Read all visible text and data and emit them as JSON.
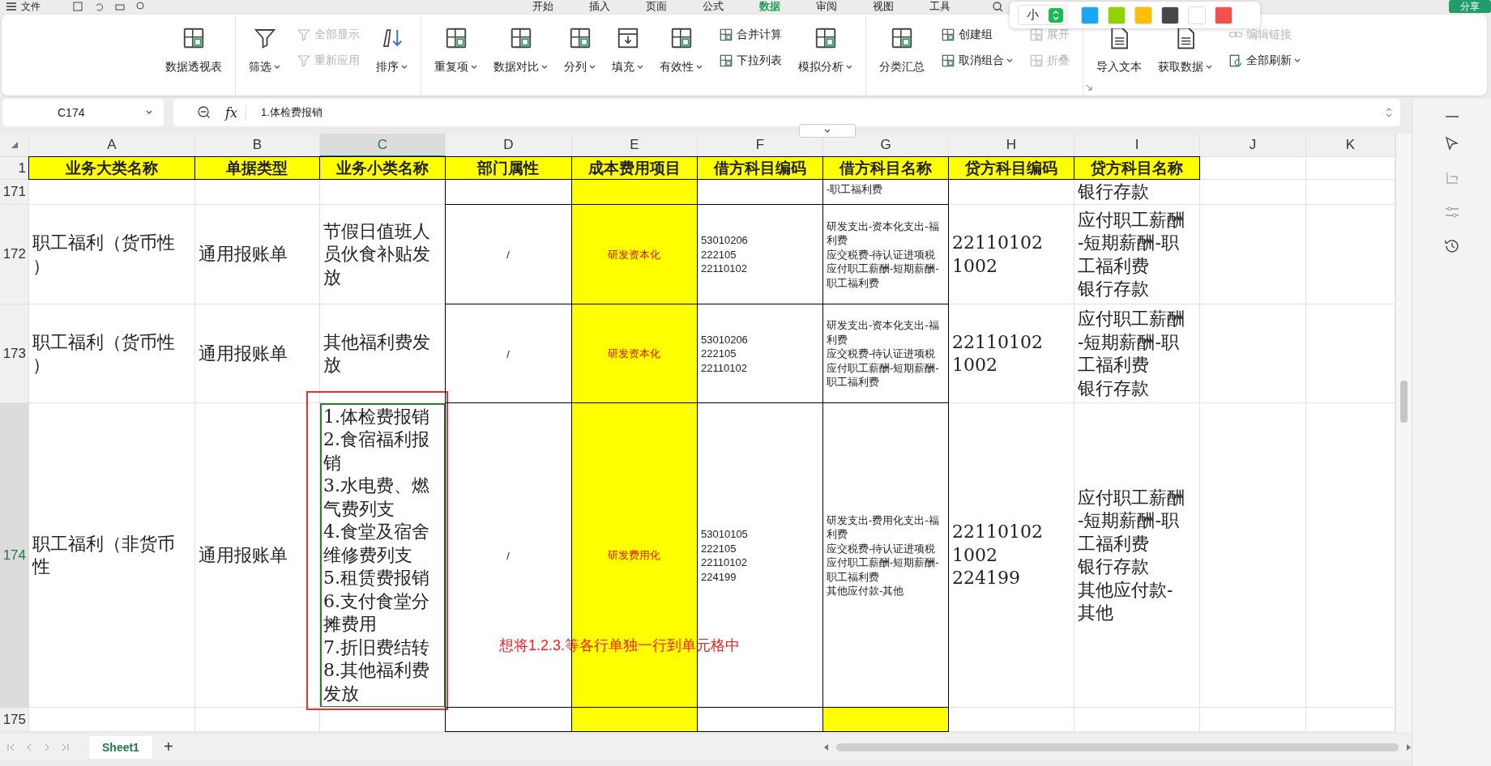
{
  "menu_bar": {
    "file": "文件",
    "tabs": [
      {
        "label": "开始",
        "selected": false
      },
      {
        "label": "插入",
        "selected": false
      },
      {
        "label": "页面",
        "selected": false
      },
      {
        "label": "公式",
        "selected": false
      },
      {
        "label": "数据",
        "selected": true
      },
      {
        "label": "审阅",
        "selected": false
      },
      {
        "label": "视图",
        "selected": false
      },
      {
        "label": "工具",
        "selected": false
      }
    ],
    "share": "分享"
  },
  "color_popup": {
    "size": "小",
    "swatches": [
      {
        "color": "#16a8f5"
      },
      {
        "color": "#8fd400"
      },
      {
        "color": "#ffc000"
      },
      {
        "color": "#474747"
      },
      {
        "color": "#ffffff"
      },
      {
        "color": "#f5504a"
      }
    ]
  },
  "ribbon": {
    "groups": [
      {
        "columns": [
          {
            "kind": "large",
            "items": [
              {
                "label": "数据透视表",
                "dropdown": false,
                "disabled": false
              }
            ]
          }
        ]
      },
      {
        "columns": [
          {
            "kind": "large",
            "items": [
              {
                "label": "筛选",
                "dropdown": true,
                "disabled": false
              }
            ]
          },
          {
            "kind": "stack",
            "items": [
              {
                "label": "全部显示",
                "dropdown": false,
                "disabled": true
              },
              {
                "label": "重新应用",
                "dropdown": false,
                "disabled": true
              }
            ]
          },
          {
            "kind": "large",
            "items": [
              {
                "label": "排序",
                "dropdown": true,
                "disabled": false
              }
            ]
          }
        ]
      },
      {
        "columns": [
          {
            "kind": "large",
            "items": [
              {
                "label": "重复项",
                "dropdown": true,
                "disabled": false
              }
            ]
          },
          {
            "kind": "large",
            "items": [
              {
                "label": "数据对比",
                "dropdown": true,
                "disabled": false
              }
            ]
          },
          {
            "kind": "large",
            "items": [
              {
                "label": "分列",
                "dropdown": true,
                "disabled": false
              }
            ]
          },
          {
            "kind": "large",
            "items": [
              {
                "label": "填充",
                "dropdown": true,
                "disabled": false
              }
            ]
          },
          {
            "kind": "large",
            "items": [
              {
                "label": "有效性",
                "dropdown": true,
                "disabled": false
              }
            ]
          },
          {
            "kind": "stack",
            "items": [
              {
                "label": "合并计算",
                "dropdown": false,
                "disabled": false
              },
              {
                "label": "下拉列表",
                "dropdown": false,
                "disabled": false
              }
            ]
          },
          {
            "kind": "large",
            "items": [
              {
                "label": "模拟分析",
                "dropdown": true,
                "disabled": false
              }
            ]
          }
        ]
      },
      {
        "columns": [
          {
            "kind": "large",
            "items": [
              {
                "label": "分类汇总",
                "dropdown": false,
                "disabled": false
              }
            ]
          },
          {
            "kind": "stack",
            "items": [
              {
                "label": "创建组",
                "dropdown": false,
                "disabled": false
              },
              {
                "label": "取消组合",
                "dropdown": true,
                "disabled": false
              }
            ]
          },
          {
            "kind": "stack",
            "items": [
              {
                "label": "展开",
                "dropdown": false,
                "disabled": true
              },
              {
                "label": "折叠",
                "dropdown": false,
                "disabled": true
              }
            ]
          }
        ]
      },
      {
        "columns": [
          {
            "kind": "large",
            "items": [
              {
                "label": "导入文本",
                "dropdown": false,
                "disabled": false
              }
            ]
          },
          {
            "kind": "large",
            "items": [
              {
                "label": "获取数据",
                "dropdown": true,
                "disabled": false
              }
            ]
          },
          {
            "kind": "stack",
            "items": [
              {
                "label": "编辑链接",
                "dropdown": false,
                "disabled": true
              },
              {
                "label": "全部刷新",
                "dropdown": true,
                "disabled": false
              }
            ]
          }
        ]
      }
    ]
  },
  "formula_bar": {
    "cell_ref": "C174",
    "fx": "fx",
    "formula": "1.体检费报销"
  },
  "sheet": {
    "columns": [
      {
        "label": "A",
        "selected": false
      },
      {
        "label": "B",
        "selected": false
      },
      {
        "label": "C",
        "selected": true
      },
      {
        "label": "D",
        "selected": false
      },
      {
        "label": "E",
        "selected": false
      },
      {
        "label": "F",
        "selected": false
      },
      {
        "label": "G",
        "selected": false
      },
      {
        "label": "H",
        "selected": false
      },
      {
        "label": "I",
        "selected": false
      },
      {
        "label": "J",
        "selected": false
      },
      {
        "label": "K",
        "selected": false
      }
    ],
    "rows": [
      {
        "number": "1",
        "selected": false,
        "cells": [
          {
            "kind": "header",
            "text": "业务大类名称",
            "color": "#ffff00",
            "bordered": true,
            "selected": false
          },
          {
            "kind": "header",
            "text": "单据类型",
            "color": "#ffff00",
            "bordered": true,
            "selected": false
          },
          {
            "kind": "header",
            "text": "业务小类名称",
            "color": "#ffff00",
            "bordered": true,
            "selected": false
          },
          {
            "kind": "header",
            "text": "部门属性",
            "color": "#ffff00",
            "bordered": true,
            "selected": false
          },
          {
            "kind": "header",
            "text": "成本费用项目",
            "color": "#ffff00",
            "bordered": true,
            "selected": false
          },
          {
            "kind": "header",
            "text": "借方科目编码",
            "color": "#ffff00",
            "bordered": true,
            "selected": false
          },
          {
            "kind": "header",
            "text": "借方科目名称",
            "color": "#ffff00",
            "bordered": true,
            "selected": false
          },
          {
            "kind": "header",
            "text": "贷方科目编码",
            "color": "#ffff00",
            "bordered": true,
            "selected": false
          },
          {
            "kind": "header",
            "text": "贷方科目名称",
            "color": "#ffff00",
            "bordered": true,
            "selected": false
          }
        ]
      },
      {
        "number": "171",
        "selected": false,
        "cells": [
          "",
          "",
          "",
          {
            "kind": "centered",
            "bordered": true,
            "selected": false
          },
          {
            "kind": "flagged",
            "color": "#ffff00",
            "bordered": true,
            "selected": false
          },
          {
            "kind": "small",
            "bordered": true,
            "selected": false
          },
          {
            "kind": "top",
            "text": "-职工福利费",
            "bordered": true,
            "selected": false
          },
          "",
          {
            "kind": "large",
            "text": "银行存款",
            "bordered": false,
            "selected": false
          }
        ]
      },
      {
        "number": "172",
        "selected": false,
        "cells": [
          {
            "kind": "large",
            "text": "职工福利（货币性）",
            "bordered": false,
            "selected": false
          },
          {
            "kind": "large",
            "text": "通用报账单",
            "bordered": false,
            "selected": false
          },
          {
            "kind": "large",
            "text": "节假日值班人员伙食补贴发放",
            "bordered": false,
            "selected": false
          },
          {
            "kind": "centered",
            "text": "/",
            "bordered": true,
            "selected": false
          },
          {
            "kind": "flagged",
            "text": "研发资本化",
            "color": "#ffff00",
            "bordered": true,
            "selected": false
          },
          {
            "kind": "small",
            "lines": [
              "53010206",
              "222105",
              "22110102"
            ],
            "bordered": true,
            "selected": false
          },
          {
            "kind": "small",
            "lines": [
              "研发支出-资本化支出-福利费",
              "应交税费-待认证进项税",
              "应付职工薪酬-短期薪酬-职工福利费"
            ],
            "bordered": true,
            "selected": false
          },
          {
            "kind": "large",
            "lines": [
              "22110102",
              "1002"
            ],
            "bordered": false,
            "selected": false
          },
          {
            "kind": "large",
            "lines": [
              "应付职工薪酬-短期薪酬-职工福利费",
              "银行存款"
            ],
            "bordered": false,
            "selected": false
          }
        ]
      },
      {
        "number": "173",
        "selected": false,
        "cells": [
          {
            "kind": "large",
            "text": "职工福利（货币性）",
            "bordered": false,
            "selected": false
          },
          {
            "kind": "large",
            "text": "通用报账单",
            "bordered": false,
            "selected": false
          },
          {
            "kind": "large",
            "text": "其他福利费发放",
            "bordered": false,
            "selected": false
          },
          {
            "kind": "centered",
            "text": "/",
            "bordered": true,
            "selected": false
          },
          {
            "kind": "flagged",
            "text": "研发资本化",
            "color": "#ffff00",
            "bordered": true,
            "selected": false
          },
          {
            "kind": "small",
            "lines": [
              "53010206",
              "222105",
              "22110102"
            ],
            "bordered": true,
            "selected": false
          },
          {
            "kind": "small",
            "lines": [
              "研发支出-资本化支出-福利费",
              "应交税费-待认证进项税",
              "应付职工薪酬-短期薪酬-职工福利费"
            ],
            "bordered": true,
            "selected": false
          },
          {
            "kind": "large",
            "lines": [
              "22110102",
              "1002"
            ],
            "bordered": false,
            "selected": false
          },
          {
            "kind": "large",
            "lines": [
              "应付职工薪酬-短期薪酬-职工福利费",
              "银行存款"
            ],
            "bordered": false,
            "selected": false
          }
        ]
      },
      {
        "number": "174",
        "selected": true,
        "cells": [
          {
            "kind": "large",
            "text": "职工福利（非货币性",
            "bordered": false,
            "selected": false
          },
          {
            "kind": "large",
            "text": "通用报账单",
            "bordered": false,
            "selected": false
          },
          {
            "kind": "large",
            "lines": [
              "1.体检费报销",
              "2.食宿福利报销",
              "3.水电费、燃气费列支",
              "4.食堂及宿舍维修费列支",
              "5.租赁费报销",
              "6.支付食堂分摊费用",
              "7.折旧费结转",
              "8.其他福利费发放"
            ],
            "bordered": false,
            "selected": true
          },
          {
            "kind": "centered",
            "text": "/",
            "bordered": true,
            "selected": false
          },
          {
            "kind": "flagged",
            "text": "研发费用化",
            "color": "#ffff00",
            "bordered": true,
            "selected": false
          },
          {
            "kind": "small",
            "lines": [
              "53010105",
              "222105",
              "22110102",
              "224199"
            ],
            "bordered": true,
            "selected": false
          },
          {
            "kind": "small",
            "lines": [
              "研发支出-费用化支出-福利费",
              "应交税费-待认证进项税",
              "应付职工薪酬-短期薪酬-职工福利费",
              "其他应付款-其他"
            ],
            "bordered": true,
            "selected": false
          },
          {
            "kind": "large",
            "lines": [
              "22110102",
              "1002",
              "224199"
            ],
            "bordered": false,
            "selected": false
          },
          {
            "kind": "large",
            "lines": [
              "应付职工薪酬-短期薪酬-职工福利费",
              "银行存款",
              "其他应付款-其他"
            ],
            "bordered": false,
            "selected": false
          }
        ]
      },
      {
        "number": "175",
        "selected": false,
        "cells": [
          "",
          "",
          "",
          {
            "kind": "centered",
            "bordered": true,
            "selected": false
          },
          {
            "kind": "flagged",
            "color": "#ffff00",
            "bordered": true,
            "selected": false
          },
          {
            "kind": "small",
            "bordered": true,
            "selected": false
          },
          {
            "kind": "small",
            "color": "#ffff00",
            "bordered": true,
            "selected": false
          }
        ]
      }
    ]
  },
  "annotation": {
    "text": "想将1.2.3.等各行单独一行到单元格中"
  },
  "sheet_tabs": [
    {
      "label": "Sheet1",
      "selected": true
    }
  ],
  "add_sheet": "+"
}
